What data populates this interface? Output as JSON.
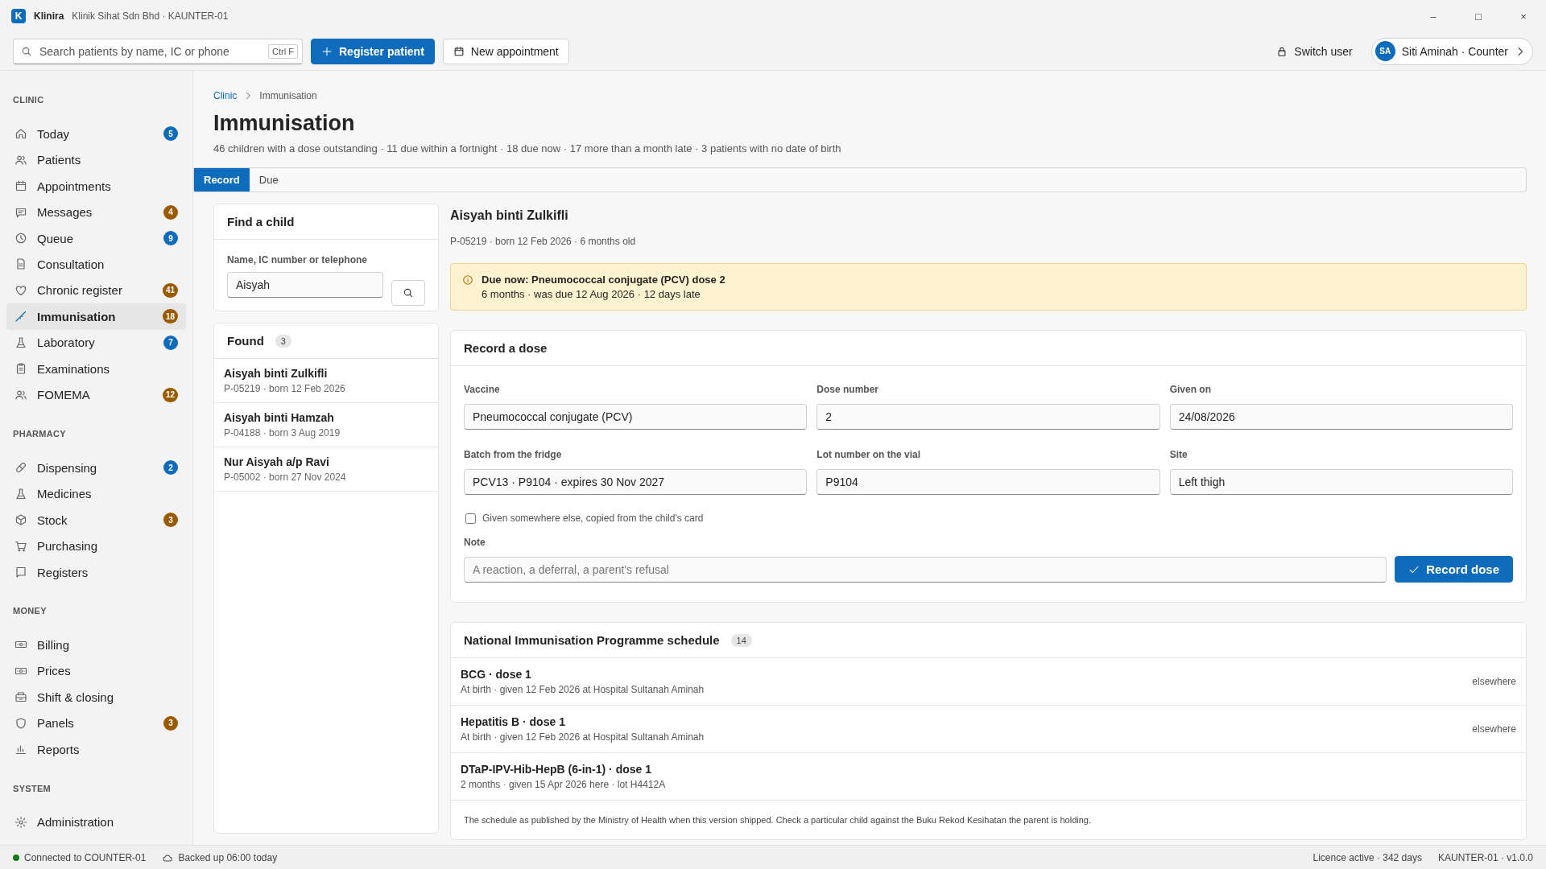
{
  "window": {
    "app": "Klinira",
    "logo": "K",
    "title": "Klinik Sihat Sdn Bhd · KAUNTER-01",
    "controls": [
      "–",
      "□",
      "×"
    ]
  },
  "toolbar": {
    "search": {
      "placeholder": "Search patients by name, IC or phone",
      "shortcut": "Ctrl F"
    },
    "primary": "Register patient",
    "secondary": "New appointment",
    "switch_user": "Switch user",
    "user": {
      "initials": "SA",
      "label": "Siti Aminah · Counter"
    }
  },
  "sidebar": {
    "sections": [
      {
        "title": "CLINIC",
        "items": [
          {
            "label": "Today",
            "badge": "5",
            "color": "#0f6cbd",
            "selected": false
          },
          {
            "label": "Patients",
            "selected": false
          },
          {
            "label": "Appointments",
            "selected": false
          },
          {
            "label": "Messages",
            "badge": "4",
            "color": "#9a5a00",
            "selected": false
          },
          {
            "label": "Queue",
            "badge": "9",
            "color": "#0f6cbd",
            "selected": false
          },
          {
            "label": "Consultation",
            "selected": false
          },
          {
            "label": "Chronic register",
            "badge": "41",
            "color": "#9a5a00",
            "selected": false
          },
          {
            "label": "Immunisation",
            "badge": "18",
            "color": "#9a5a00",
            "selected": true
          },
          {
            "label": "Laboratory",
            "badge": "7",
            "color": "#0f6cbd",
            "selected": false
          },
          {
            "label": "Examinations",
            "selected": false
          },
          {
            "label": "FOMEMA",
            "badge": "12",
            "color": "#9a5a00",
            "selected": false
          }
        ]
      },
      {
        "title": "PHARMACY",
        "items": [
          {
            "label": "Dispensing",
            "badge": "2",
            "color": "#0f6cbd",
            "selected": false
          },
          {
            "label": "Medicines",
            "selected": false
          },
          {
            "label": "Stock",
            "badge": "3",
            "color": "#9a5a00",
            "selected": false
          },
          {
            "label": "Purchasing",
            "selected": false
          },
          {
            "label": "Registers",
            "selected": false
          }
        ]
      },
      {
        "title": "MONEY",
        "items": [
          {
            "label": "Billing",
            "selected": false
          },
          {
            "label": "Prices",
            "selected": false
          },
          {
            "label": "Shift & closing",
            "selected": false
          },
          {
            "label": "Panels",
            "badge": "3",
            "color": "#9a5a00",
            "selected": false
          },
          {
            "label": "Reports",
            "selected": false
          }
        ]
      },
      {
        "title": "SYSTEM",
        "items": [
          {
            "label": "Administration",
            "selected": false
          }
        ]
      }
    ]
  },
  "breadcrumb": [
    "Clinic",
    "Immunisation"
  ],
  "page": {
    "title": "Immunisation",
    "summary": "46 children with a dose outstanding · 11 due within a fortnight · 18 due now · 17 more than a month late · 3 patients with no date of birth"
  },
  "tabs": [
    {
      "label": "Record",
      "selected": true
    },
    {
      "label": "Due",
      "selected": false
    }
  ],
  "find": {
    "title": "Find a child",
    "label": "Name, IC number or telephone",
    "value": "Aisyah"
  },
  "found": {
    "title": "Found",
    "count": "3",
    "results": [
      {
        "name": "Aisyah binti Zulkifli",
        "meta": "P-05219 · born 12 Feb 2026"
      },
      {
        "name": "Aisyah binti Hamzah",
        "meta": "P-04188 · born 3 Aug 2019"
      },
      {
        "name": "Nur Aisyah a/p Ravi",
        "meta": "P-05002 · born 27 Nov 2024"
      }
    ]
  },
  "patient": {
    "name": "Aisyah binti Zulkifli",
    "meta": "P-05219 · born 12 Feb 2026 · 6 months old"
  },
  "alert": {
    "title": "Due now: Pneumococcal conjugate (PCV) dose 2",
    "detail": "6 months · was due 12 Aug 2026 · 12 days late"
  },
  "record": {
    "title": "Record a dose",
    "fields": [
      {
        "label": "Vaccine",
        "value": "Pneumococcal conjugate (PCV)"
      },
      {
        "label": "Dose number",
        "value": "2"
      },
      {
        "label": "Given on",
        "value": "24/08/2026"
      },
      {
        "label": "Batch from the fridge",
        "value": "PCV13 · P9104 · expires 30 Nov 2027"
      },
      {
        "label": "Lot number on the vial",
        "value": "P9104"
      },
      {
        "label": "Site",
        "value": "Left thigh"
      }
    ],
    "elsewhere": {
      "label": "Given somewhere else, copied from the child's card",
      "checked": false
    },
    "note": {
      "label": "Note",
      "placeholder": "A reaction, a deferral, a parent's refusal"
    },
    "button": "Record dose"
  },
  "schedule": {
    "title": "National Immunisation Programme schedule",
    "count": "14",
    "rows": [
      {
        "title": "BCG · dose 1",
        "detail": "At birth · given 12 Feb 2026 at Hospital Sultanah Aminah",
        "tag": "elsewhere"
      },
      {
        "title": "Hepatitis B · dose 1",
        "detail": "At birth · given 12 Feb 2026 at Hospital Sultanah Aminah",
        "tag": "elsewhere"
      },
      {
        "title": "DTaP-IPV-Hib-HepB (6-in-1) · dose 1",
        "detail": "2 months · given 15 Apr 2026 here · lot H4412A"
      }
    ],
    "footnote": "The schedule as published by the Ministry of Health when this version shipped. Check a particular child against the Buku Rekod Kesihatan the parent is holding."
  },
  "status_bar": {
    "connection": "Connected to COUNTER-01",
    "backup": "Backed up 06:00 today",
    "licence": "Licence active · 342 days",
    "version": "KAUNTER-01 · v1.0.0"
  }
}
